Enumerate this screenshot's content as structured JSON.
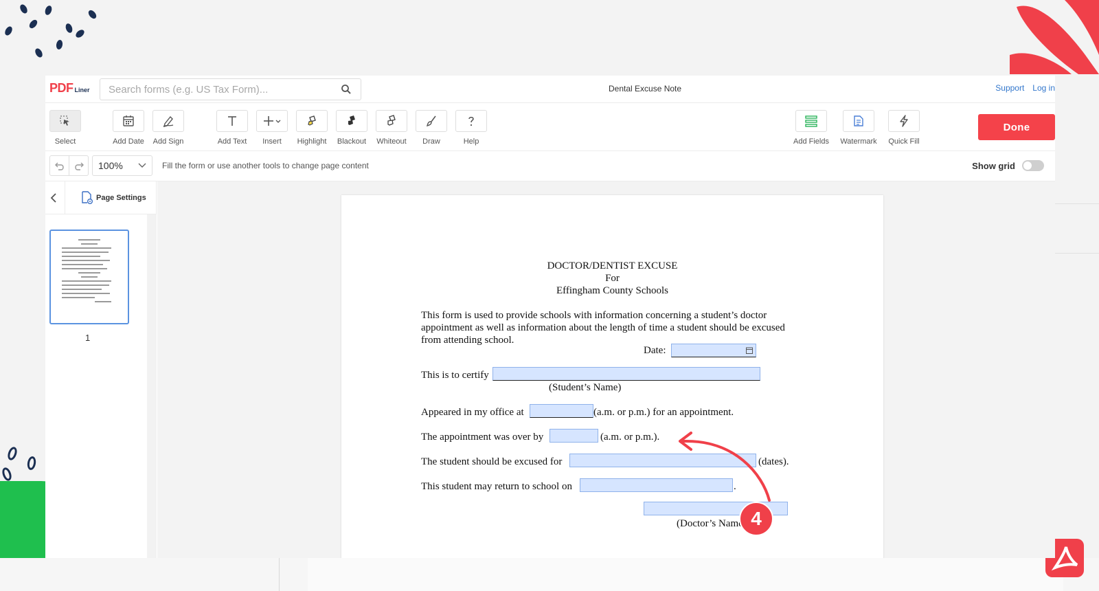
{
  "app": {
    "logo_main": "PDF",
    "logo_sub": "Liner",
    "doc_title": "Dental Excuse Note",
    "support_label": "Support",
    "login_label": "Log in"
  },
  "search": {
    "placeholder": "Search forms (e.g. US Tax Form)...",
    "value": ""
  },
  "toolbar": {
    "select": "Select",
    "add_date": "Add Date",
    "add_sign": "Add Sign",
    "add_text": "Add Text",
    "insert": "Insert",
    "highlight": "Highlight",
    "blackout": "Blackout",
    "whiteout": "Whiteout",
    "draw": "Draw",
    "help": "Help",
    "add_fields": "Add Fields",
    "watermark": "Watermark",
    "quick_fill": "Quick Fill",
    "done": "Done"
  },
  "subbar": {
    "zoom": "100%",
    "hint": "Fill the form or use another tools to change page content",
    "show_grid": "Show grid",
    "show_grid_on": false
  },
  "sidebar": {
    "page_settings": "Page Settings",
    "page_number": "1"
  },
  "document": {
    "title": "DOCTOR/DENTIST EXCUSE",
    "title_for": "For",
    "school": "Effingham County Schools",
    "intro": "This form is used to provide schools with information concerning a student’s doctor appointment as well as information about the length of time a student should be excused from attending school.",
    "date_label": "Date:",
    "certify_label": "This is to certify",
    "student_caption": "(Student’s Name)",
    "office_label": "Appeared in my office at",
    "office_suffix": "(a.m. or p.m.) for an appointment.",
    "over_label": "The appointment was over by",
    "over_suffix": "(a.m. or p.m.).",
    "excused_label": "The student should be excused for",
    "excused_suffix": "(dates).",
    "return_label": "This student may return to school on",
    "return_suffix": ".",
    "doctor_caption": "(Doctor’s Name)"
  },
  "tutorial": {
    "step": "4"
  },
  "colors": {
    "accent": "#f4424a",
    "field_fill": "#d6e5ff",
    "link": "#3377cc",
    "thumb_border": "#5b93e0"
  }
}
